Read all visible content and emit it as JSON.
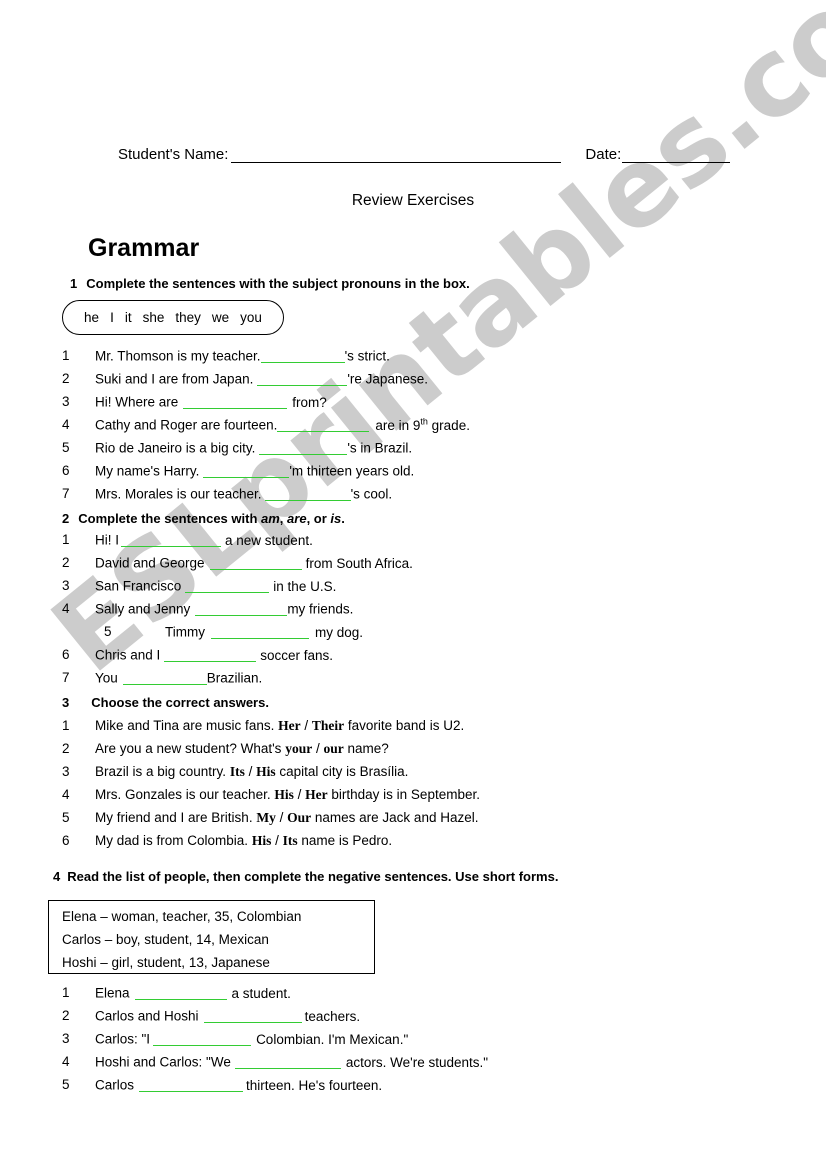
{
  "watermark": {
    "text": "ESLprintables.com",
    "color": "#cccccc"
  },
  "header": {
    "student_name_label": "Student's Name:",
    "date_label": "Date:"
  },
  "doc_title": "Review Exercises",
  "section_title": "Grammar",
  "accent_blank_color": "#33cc33",
  "exercises": [
    {
      "number": "1",
      "heading": "Complete the sentences with the subject pronouns in the box.",
      "word_box": [
        "he",
        "I",
        "it",
        "she",
        "they",
        "we",
        "you"
      ],
      "items": [
        {
          "num": "1",
          "before": "Mr. Thomson is my teacher.",
          "after": "'s strict."
        },
        {
          "num": "2",
          "before": "Suki and I are from Japan.",
          "after": "'re Japanese."
        },
        {
          "num": "3",
          "before": "Hi! Where are",
          "after": "from?"
        },
        {
          "num": "4",
          "before": "Cathy and Roger are fourteen.",
          "after": "are in 9th grade."
        },
        {
          "num": "5",
          "before": "Rio de Janeiro is a big city.",
          "after": "'s in Brazil."
        },
        {
          "num": "6",
          "before": "My name's Harry.",
          "after": "'m thirteen years old."
        },
        {
          "num": "7",
          "before": "Mrs. Morales is our teacher.",
          "after": "'s cool."
        }
      ]
    },
    {
      "number": "2",
      "heading_pre": "Complete the sentences with ",
      "heading_italic_1": "am",
      "heading_mid_1": ", ",
      "heading_italic_2": "are",
      "heading_mid_2": ", or ",
      "heading_italic_3": "is",
      "heading_post": ".",
      "items": [
        {
          "num": "1",
          "before": "Hi! I",
          "after": "a new student."
        },
        {
          "num": "2",
          "before": "David and George",
          "after": "from South Africa."
        },
        {
          "num": "3",
          "before": "San Francisco",
          "after": "in the U.S."
        },
        {
          "num": "4",
          "before": "Sally and Jenny",
          "after": "my friends."
        },
        {
          "num": "5",
          "before": "Timmy",
          "after": "my dog."
        },
        {
          "num": "6",
          "before": "Chris and I",
          "after": "soccer fans."
        },
        {
          "num": "7",
          "before": "You",
          "after": "Brazilian."
        }
      ]
    },
    {
      "number": "3",
      "heading": "Choose the correct answers.",
      "items": [
        {
          "num": "1",
          "before": "Mike and Tina are music fans.",
          "choice_a": "Her",
          "choice_b": "Their",
          "after": "favorite band is U2."
        },
        {
          "num": "2",
          "before": "Are you a new student? What's",
          "choice_a": "your",
          "choice_b": "our",
          "after": "name?"
        },
        {
          "num": "3",
          "before": "Brazil is a big country.",
          "choice_a": "Its",
          "choice_b": "His",
          "after": "capital city is Brasília."
        },
        {
          "num": "4",
          "before": "Mrs. Gonzales is our teacher.",
          "choice_a": "His",
          "choice_b": "Her",
          "after": "birthday is in September."
        },
        {
          "num": "5",
          "before": "My friend and I are British.",
          "choice_a": "My",
          "choice_b": "Our",
          "after": "names are Jack and Hazel."
        },
        {
          "num": "6",
          "before": "My dad is from Colombia.",
          "choice_a": "His",
          "choice_b": "Its",
          "after": "name is Pedro."
        }
      ]
    },
    {
      "number": "4",
      "heading": "Read the list of people, then complete the negative sentences. Use short forms.",
      "list_box": [
        "Elena – woman, teacher, 35, Colombian",
        "Carlos – boy, student, 14, Mexican",
        "Hoshi – girl, student, 13, Japanese"
      ],
      "items": [
        {
          "num": "1",
          "before": "Elena",
          "after": "a student."
        },
        {
          "num": "2",
          "before": "Carlos and Hoshi",
          "after": "teachers."
        },
        {
          "num": "3",
          "before": "Carlos: \"I",
          "after": "Colombian. I'm Mexican.\""
        },
        {
          "num": "4",
          "before": "Hoshi and Carlos: \"We",
          "after": "actors. We're students.\""
        },
        {
          "num": "5",
          "before": "Carlos",
          "after": "thirteen. He's fourteen."
        }
      ]
    }
  ]
}
